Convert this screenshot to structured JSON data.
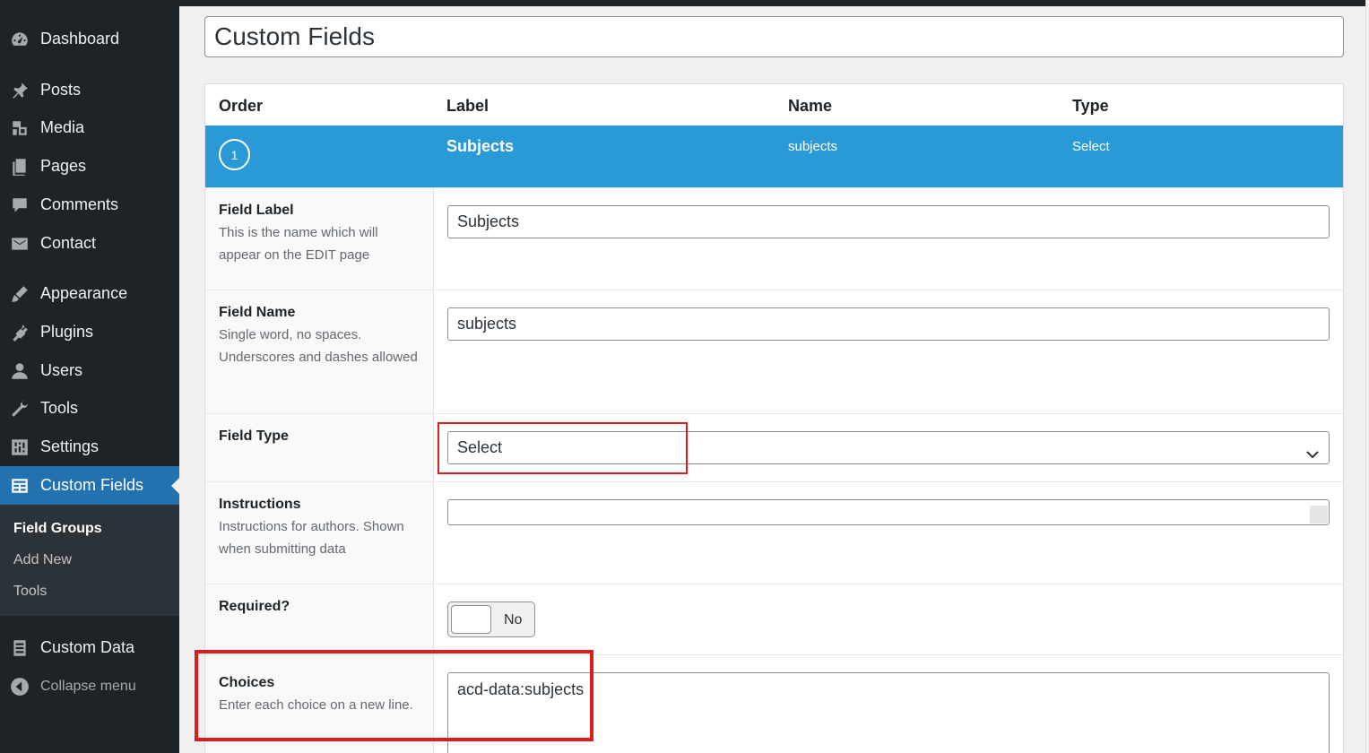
{
  "sidebar": {
    "items": [
      {
        "label": "Dashboard",
        "icon": "dashboard-icon"
      },
      {
        "label": "Posts",
        "icon": "pin-icon"
      },
      {
        "label": "Media",
        "icon": "media-icon"
      },
      {
        "label": "Pages",
        "icon": "pages-icon"
      },
      {
        "label": "Comments",
        "icon": "comment-icon"
      },
      {
        "label": "Contact",
        "icon": "mail-icon"
      },
      {
        "label": "Appearance",
        "icon": "brush-icon"
      },
      {
        "label": "Plugins",
        "icon": "plugin-icon"
      },
      {
        "label": "Users",
        "icon": "user-icon"
      },
      {
        "label": "Tools",
        "icon": "wrench-icon"
      },
      {
        "label": "Settings",
        "icon": "settings-icon"
      },
      {
        "label": "Custom Fields",
        "icon": "fields-icon"
      },
      {
        "label": "Custom Data",
        "icon": "data-icon"
      }
    ],
    "submenu": [
      "Field Groups",
      "Add New",
      "Tools"
    ],
    "collapse_label": "Collapse menu"
  },
  "title_value": "Custom Fields",
  "table": {
    "headers": [
      "Order",
      "Label",
      "Name",
      "Type"
    ],
    "field": {
      "order": "1",
      "label": "Subjects",
      "name": "subjects",
      "type": "Select"
    }
  },
  "rows": {
    "field_label": {
      "title": "Field Label",
      "desc": "This is the name which will appear on the EDIT page",
      "value": "Subjects"
    },
    "field_name": {
      "title": "Field Name",
      "desc": "Single word, no spaces. Underscores and dashes allowed",
      "value": "subjects"
    },
    "field_type": {
      "title": "Field Type",
      "value": "Select"
    },
    "instructions": {
      "title": "Instructions",
      "desc": "Instructions for authors. Shown when submitting data"
    },
    "required": {
      "title": "Required?",
      "toggle_text": "No"
    },
    "choices": {
      "title": "Choices",
      "desc": "Enter each choice on a new line.",
      "value": "acd-data:subjects"
    }
  },
  "colors": {
    "sidebar_bg": "#1d2327",
    "active": "#2271b1",
    "field_header": "#2a9ad6",
    "highlight": "#e01b1b"
  }
}
